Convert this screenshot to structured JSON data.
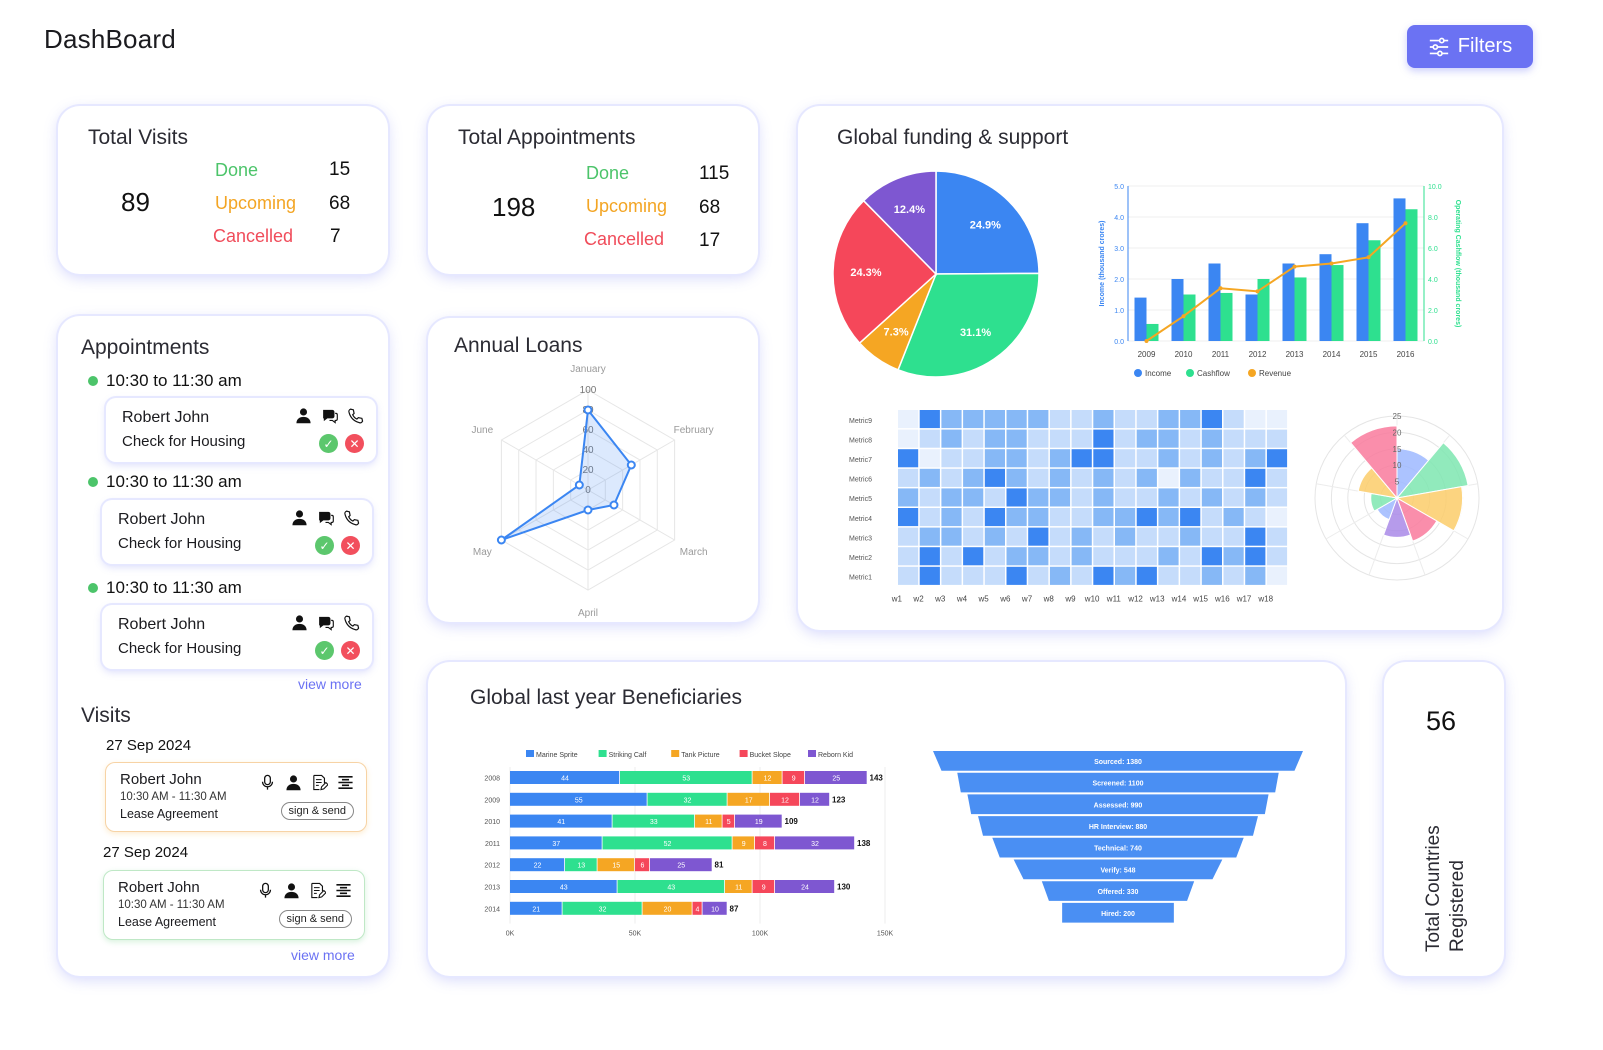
{
  "page": {
    "title": "DashBoard",
    "filters_label": "Filters"
  },
  "colors": {
    "accent": "#6b72f3",
    "done": "#4cc46a",
    "upcoming": "#f3a524",
    "cancelled": "#f04c5a",
    "blue": "#3b86f2",
    "green": "#2ee08f",
    "orange": "#f5a623",
    "red": "#f5475a",
    "purple": "#7e57d1"
  },
  "visits_card": {
    "title": "Total Visits",
    "total": "89",
    "done_label": "Done",
    "done_value": "15",
    "upcoming_label": "Upcoming",
    "upcoming_value": "68",
    "cancelled_label": "Cancelled",
    "cancelled_value": "7"
  },
  "appointments_card": {
    "title": "Total Appointments",
    "total": "198",
    "done_label": "Done",
    "done_value": "115",
    "upcoming_label": "Upcoming",
    "upcoming_value": "68",
    "cancelled_label": "Cancelled",
    "cancelled_value": "17"
  },
  "appointments_list": {
    "title": "Appointments",
    "items": [
      {
        "time": "10:30 to 11:30 am",
        "name": "Robert John",
        "desc": "Check for Housing"
      },
      {
        "time": "10:30 to 11:30 am",
        "name": "Robert John",
        "desc": "Check for Housing"
      },
      {
        "time": "10:30 to 11:30 am",
        "name": "Robert John",
        "desc": "Check for Housing"
      }
    ],
    "view_more": "view more",
    "icons": [
      "user-icon",
      "chat-icon",
      "phone-icon",
      "check-icon",
      "close-icon"
    ]
  },
  "visits_list": {
    "title": "Visits",
    "items": [
      {
        "date": "27 Sep 2024",
        "name": "Robert John",
        "time": "10:30 AM - 11:30 AM",
        "desc": "Lease Agreement",
        "action": "sign & send"
      },
      {
        "date": "27 Sep 2024",
        "name": "Robert John",
        "time": "10:30 AM - 11:30 AM",
        "desc": "Lease Agreement",
        "action": "sign & send"
      }
    ],
    "view_more": "view more",
    "icons": [
      "mic-icon",
      "user-icon",
      "edit-document-icon",
      "list-icon"
    ]
  },
  "annual_loans": {
    "title": "Annual Loans"
  },
  "global_funding": {
    "title": "Global funding & support"
  },
  "beneficiaries": {
    "title": "Global last year Beneficiaries"
  },
  "countries": {
    "value": "56",
    "label_line1": "Total Countries",
    "label_line2": "Registered"
  },
  "chart_data": [
    {
      "id": "annual-loans-radar",
      "type": "radar",
      "axes": [
        "January",
        "February",
        "March",
        "April",
        "May",
        "June"
      ],
      "rlim": [
        0,
        100
      ],
      "rticks": [
        "0",
        "20",
        "40",
        "60",
        "80",
        "100"
      ],
      "values": [
        80,
        50,
        30,
        20,
        100,
        10
      ],
      "color": "#3b86f2"
    },
    {
      "id": "funding-pie",
      "type": "pie",
      "labels": [
        "24.9%",
        "31.1%",
        "7.3%",
        "24.3%",
        "12.4%"
      ],
      "values": [
        24.9,
        31.1,
        7.3,
        24.3,
        12.4
      ],
      "colors": [
        "#3b86f2",
        "#2ee08f",
        "#f5a623",
        "#f5475a",
        "#7e57d1"
      ]
    },
    {
      "id": "funding-combo",
      "type": "bar",
      "categories": [
        "2009",
        "2010",
        "2011",
        "2012",
        "2013",
        "2014",
        "2015",
        "2016"
      ],
      "series": [
        {
          "name": "Income",
          "type": "bar",
          "axis": "left",
          "values": [
            1.4,
            2.0,
            2.5,
            1.5,
            2.5,
            2.8,
            3.8,
            4.6
          ],
          "color": "#3b86f2"
        },
        {
          "name": "Cashflow",
          "type": "bar",
          "axis": "right",
          "values": [
            1.1,
            3.0,
            3.1,
            4.0,
            4.1,
            4.9,
            6.5,
            8.5
          ],
          "color": "#2ee08f"
        },
        {
          "name": "Revenue",
          "type": "line",
          "axis": "left",
          "values": [
            0.0,
            0.8,
            1.7,
            1.6,
            2.4,
            2.5,
            2.7,
            3.8
          ],
          "color": "#f5a623"
        }
      ],
      "ylabel": "Income (thousand crores)",
      "y2label": "Operating Cashflow (thousand crores)",
      "ylim": [
        0,
        5
      ],
      "y2lim": [
        0,
        10
      ],
      "yticks": [
        "0.0",
        "1.0",
        "2.0",
        "3.0",
        "4.0",
        "5.0"
      ],
      "y2ticks": [
        "0.0",
        "2.0",
        "4.0",
        "6.0",
        "8.0",
        "10.0"
      ],
      "legend": "bottom"
    },
    {
      "id": "funding-heatmap",
      "type": "heatmap",
      "x": [
        "w1",
        "w2",
        "w3",
        "w4",
        "w5",
        "w6",
        "w7",
        "w8",
        "w9",
        "w10",
        "w11",
        "w12",
        "w13",
        "w14",
        "w15",
        "w16",
        "w17",
        "w18"
      ],
      "y": [
        "Metric9",
        "Metric8",
        "Metric7",
        "Metric6",
        "Metric5",
        "Metric4",
        "Metric3",
        "Metric2",
        "Metric1"
      ],
      "levels": [
        [
          0,
          3,
          2,
          2,
          2,
          2,
          2,
          1,
          1,
          2,
          1,
          1,
          2,
          2,
          3,
          1,
          0,
          0
        ],
        [
          0,
          1,
          2,
          1,
          2,
          2,
          1,
          1,
          1,
          3,
          1,
          2,
          2,
          1,
          2,
          1,
          1,
          1
        ],
        [
          3,
          0,
          1,
          1,
          2,
          2,
          1,
          2,
          3,
          3,
          1,
          1,
          2,
          1,
          2,
          1,
          2,
          3
        ],
        [
          1,
          2,
          1,
          2,
          3,
          2,
          1,
          2,
          1,
          2,
          1,
          2,
          0,
          2,
          1,
          1,
          3,
          1
        ],
        [
          2,
          1,
          2,
          2,
          1,
          3,
          2,
          2,
          1,
          2,
          1,
          1,
          2,
          1,
          2,
          1,
          2,
          1
        ],
        [
          3,
          1,
          2,
          1,
          3,
          2,
          2,
          1,
          1,
          2,
          2,
          3,
          2,
          3,
          1,
          2,
          1,
          0
        ],
        [
          1,
          2,
          2,
          1,
          2,
          1,
          3,
          1,
          2,
          1,
          2,
          1,
          1,
          2,
          1,
          1,
          3,
          1
        ],
        [
          1,
          3,
          1,
          3,
          1,
          2,
          2,
          1,
          2,
          1,
          1,
          1,
          2,
          1,
          3,
          2,
          3,
          1
        ],
        [
          1,
          3,
          1,
          1,
          1,
          3,
          1,
          2,
          1,
          3,
          2,
          3,
          1,
          1,
          2,
          1,
          2,
          0
        ]
      ]
    },
    {
      "id": "funding-polar",
      "type": "polar",
      "rticks": [
        "5",
        "10",
        "15",
        "20",
        "25"
      ],
      "rlim": [
        0,
        25
      ],
      "values": [
        15,
        22,
        20,
        14,
        12,
        7,
        8,
        12,
        22
      ],
      "colors": [
        "#9db8ff",
        "#7ee6b0",
        "#fbcd6a",
        "#f97a9c",
        "#a989e8",
        "#9db8ff",
        "#7ee6b0",
        "#fbcd6a",
        "#f97a9c"
      ]
    },
    {
      "id": "beneficiaries-stacked",
      "type": "bar",
      "orientation": "horizontal",
      "categories": [
        "2008",
        "2009",
        "2010",
        "2011",
        "2012",
        "2013",
        "2014"
      ],
      "series": [
        {
          "name": "Marine Sprite",
          "values": [
            44,
            55,
            41,
            37,
            22,
            43,
            21
          ],
          "color": "#3b86f2"
        },
        {
          "name": "Striking Calf",
          "values": [
            53,
            32,
            33,
            52,
            13,
            43,
            32
          ],
          "color": "#2ee08f"
        },
        {
          "name": "Tank Picture",
          "values": [
            12,
            17,
            11,
            9,
            15,
            11,
            20
          ],
          "color": "#f5a623"
        },
        {
          "name": "Bucket Slope",
          "values": [
            9,
            12,
            5,
            8,
            6,
            9,
            4
          ],
          "color": "#f5475a"
        },
        {
          "name": "Reborn Kid",
          "values": [
            25,
            12,
            19,
            32,
            25,
            24,
            10
          ],
          "color": "#7e57d1"
        }
      ],
      "totals": [
        "143",
        "123",
        "109",
        "138",
        "81",
        "130",
        "87"
      ],
      "xticks": [
        "0K",
        "50K",
        "100K",
        "150K"
      ],
      "xlim": [
        0,
        150
      ],
      "legend": "top"
    },
    {
      "id": "beneficiaries-funnel",
      "type": "funnel",
      "labels": [
        "Sourced: 1380",
        "Screened: 1100",
        "Assessed: 990",
        "HR Interview: 880",
        "Technical: 740",
        "Verify: 548",
        "Offered: 330",
        "Hired: 200"
      ],
      "values": [
        1380,
        1100,
        990,
        880,
        740,
        548,
        330,
        200
      ],
      "color": "#4a8ff3"
    }
  ]
}
